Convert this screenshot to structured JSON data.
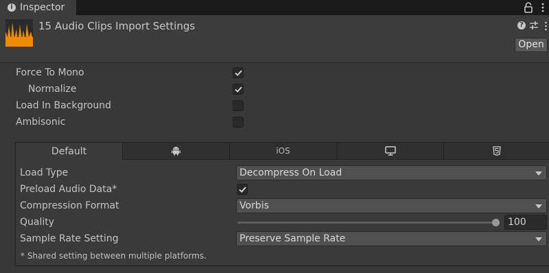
{
  "window": {
    "tab_title": "Inspector",
    "tab_icon": "info-icon",
    "lock_icon": "lock-icon",
    "menu_icon": "more-vertical-icon"
  },
  "header": {
    "title": "15 Audio Clips Import Settings",
    "asset_icon": "audio-clip-icon",
    "help_icon": "help-icon",
    "preset_icon": "preset-sliders-icon",
    "menu_icon": "more-vertical-icon",
    "open_button": "Open"
  },
  "settings": {
    "force_to_mono": {
      "label": "Force To Mono",
      "checked": true
    },
    "normalize": {
      "label": "Normalize",
      "checked": true
    },
    "load_in_background": {
      "label": "Load In Background",
      "checked": false
    },
    "ambisonic": {
      "label": "Ambisonic",
      "checked": false
    }
  },
  "platform_tabs": [
    {
      "label": "Default",
      "icon": null,
      "active": true
    },
    {
      "label": "",
      "icon": "android-icon",
      "active": false
    },
    {
      "label": "iOS",
      "icon": null,
      "active": false
    },
    {
      "label": "",
      "icon": "monitor-icon",
      "active": false
    },
    {
      "label": "",
      "icon": "html5-icon",
      "active": false
    }
  ],
  "platform_settings": {
    "load_type": {
      "label": "Load Type",
      "value": "Decompress On Load"
    },
    "preload_audio_data": {
      "label": "Preload Audio Data*",
      "checked": true
    },
    "compression_format": {
      "label": "Compression Format",
      "value": "Vorbis"
    },
    "quality": {
      "label": "Quality",
      "value": "100",
      "slider_fraction": 1.0
    },
    "sample_rate_setting": {
      "label": "Sample Rate Setting",
      "value": "Preserve Sample Rate"
    }
  },
  "footnote": "* Shared setting between multiple platforms.",
  "colors": {
    "background": "#383838",
    "asset_icon_orange": "#f08a00",
    "checkmark": "#e0e0e0"
  }
}
